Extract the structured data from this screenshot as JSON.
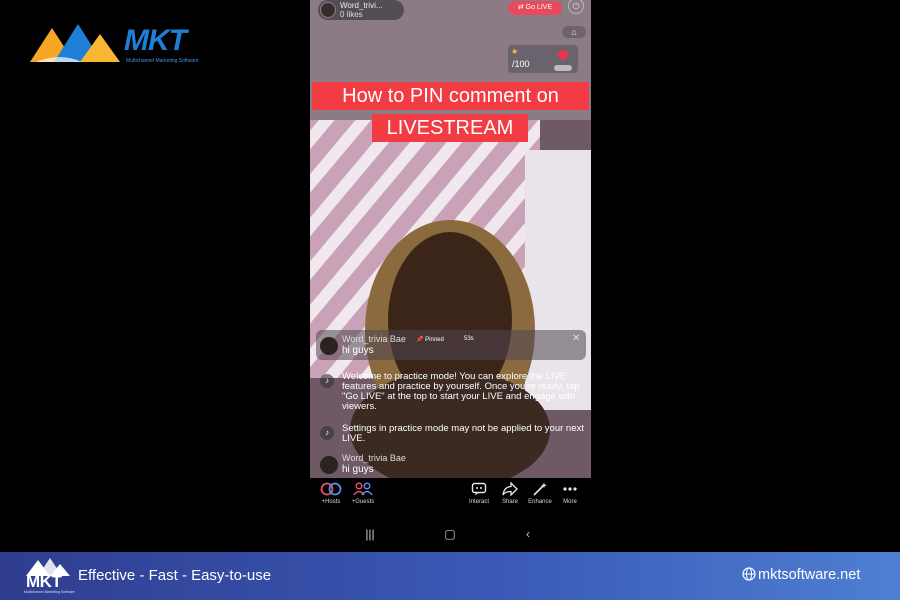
{
  "brand": {
    "logo_text": "MKT",
    "logo_subtitle": "Multichannel Marketing Software"
  },
  "live": {
    "host_name": "Word_trivi...",
    "likes": "0 likes",
    "go_live_label": "⇄ Go LIVE",
    "goal_count": "/100",
    "headline_line1": "How to PIN comment on",
    "headline_line2": "LIVESTREAM",
    "pinned": {
      "user": "Word_trivia Bae",
      "badge": "Pinned",
      "time": "53s",
      "message": "hi guys"
    },
    "system_messages": [
      "Welcome to practice mode! You can explore the LIVE features and practice by yourself. Once you're ready, tap \"Go LIVE\" at the top to start your LIVE and engage with viewers.",
      "Settings in practice mode may not be applied to your next LIVE."
    ],
    "comment": {
      "user": "Word_trivia Bae",
      "message": "hi guys"
    }
  },
  "controls": [
    {
      "label": "+Hosts",
      "icon": "hosts-icon"
    },
    {
      "label": "+Guests",
      "icon": "guests-icon"
    },
    {
      "label": "Interact",
      "icon": "interact-icon"
    },
    {
      "label": "Share",
      "icon": "share-icon"
    },
    {
      "label": "Enhance",
      "icon": "enhance-icon"
    },
    {
      "label": "More",
      "icon": "more-icon"
    }
  ],
  "footer": {
    "logo_text": "MKT",
    "logo_subtitle": "Multichannel Marketing Software",
    "tagline": "Effective - Fast - Easy-to-use",
    "website": "mktsoftware.net"
  },
  "colors": {
    "accent_red": "#f23b42",
    "footer_blue": "#3a59b6",
    "brand_blue": "#1d7fd6"
  }
}
